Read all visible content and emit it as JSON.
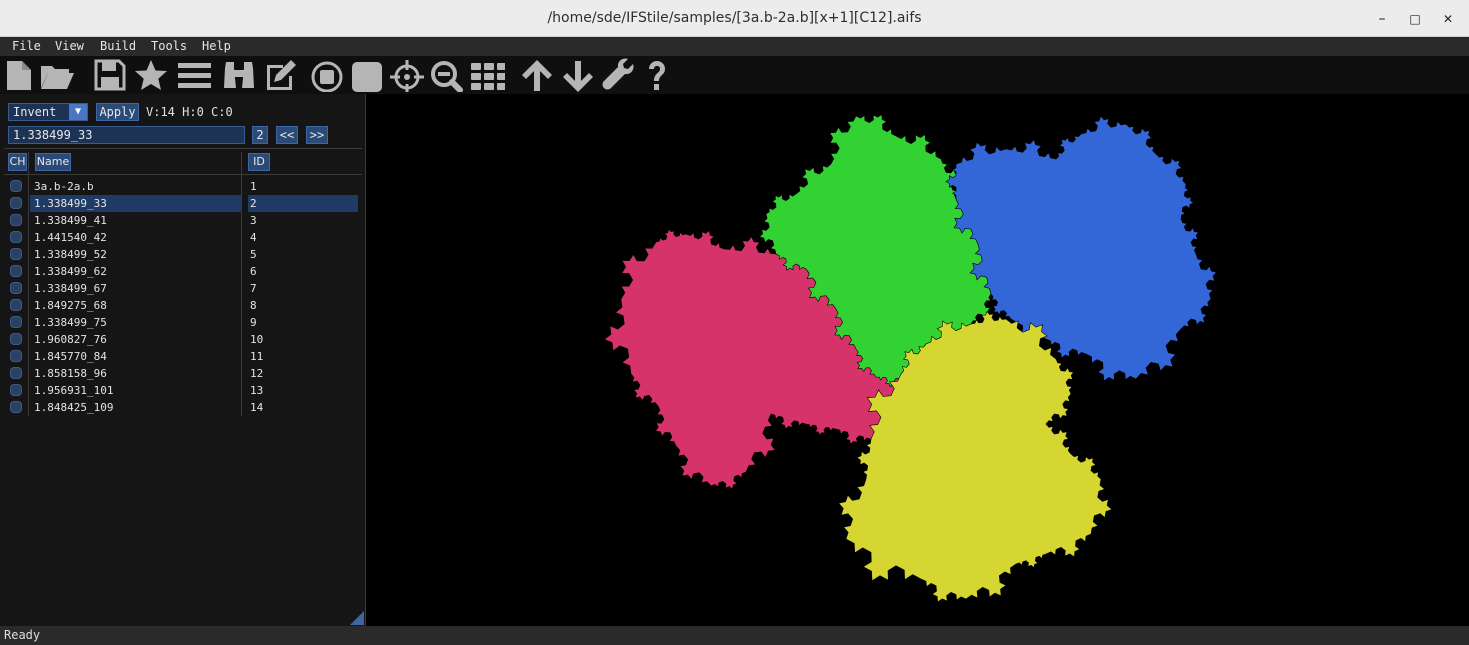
{
  "window": {
    "title": "/home/sde/IFStile/samples/[3a.b-2a.b][x+1][C12].aifs",
    "minimize": "–",
    "maximize": "□",
    "close": "✕"
  },
  "menu": [
    "File",
    "View",
    "Build",
    "Tools",
    "Help"
  ],
  "toolbar_icons": [
    "new-file-icon",
    "open-folder-icon",
    "save-icon",
    "star-icon",
    "list-icon",
    "binoculars-icon",
    "edit-icon",
    "stop-circle-icon",
    "square-icon",
    "crosshair-icon",
    "zoom-out-icon",
    "grid-icon",
    "arrow-up-icon",
    "arrow-down-icon",
    "wrench-icon",
    "help-icon"
  ],
  "controls": {
    "mode_value": "Invent",
    "apply_label": "Apply",
    "counters": "V:14 H:0 C:0",
    "search_value": "1.338499_33",
    "page_number": "2",
    "prev_label": "<<",
    "next_label": ">>"
  },
  "table": {
    "headers": {
      "ch": "CH",
      "name": "Name",
      "id": "ID"
    },
    "selected_index": 1,
    "rows": [
      {
        "name": "3a.b-2a.b",
        "id": "1"
      },
      {
        "name": "1.338499_33",
        "id": "2"
      },
      {
        "name": "1.338499_41",
        "id": "3"
      },
      {
        "name": "1.441540_42",
        "id": "4"
      },
      {
        "name": "1.338499_52",
        "id": "5"
      },
      {
        "name": "1.338499_62",
        "id": "6"
      },
      {
        "name": "1.338499_67",
        "id": "7"
      },
      {
        "name": "1.849275_68",
        "id": "8"
      },
      {
        "name": "1.338499_75",
        "id": "9"
      },
      {
        "name": "1.960827_76",
        "id": "10"
      },
      {
        "name": "1.845770_84",
        "id": "11"
      },
      {
        "name": "1.858158_96",
        "id": "12"
      },
      {
        "name": "1.956931_101",
        "id": "13"
      },
      {
        "name": "1.848425_109",
        "id": "14"
      }
    ]
  },
  "tile_colors": {
    "red": "#d6336a",
    "green": "#33d233",
    "blue": "#3366d6",
    "yellow": "#d6d633"
  },
  "status": "Ready"
}
